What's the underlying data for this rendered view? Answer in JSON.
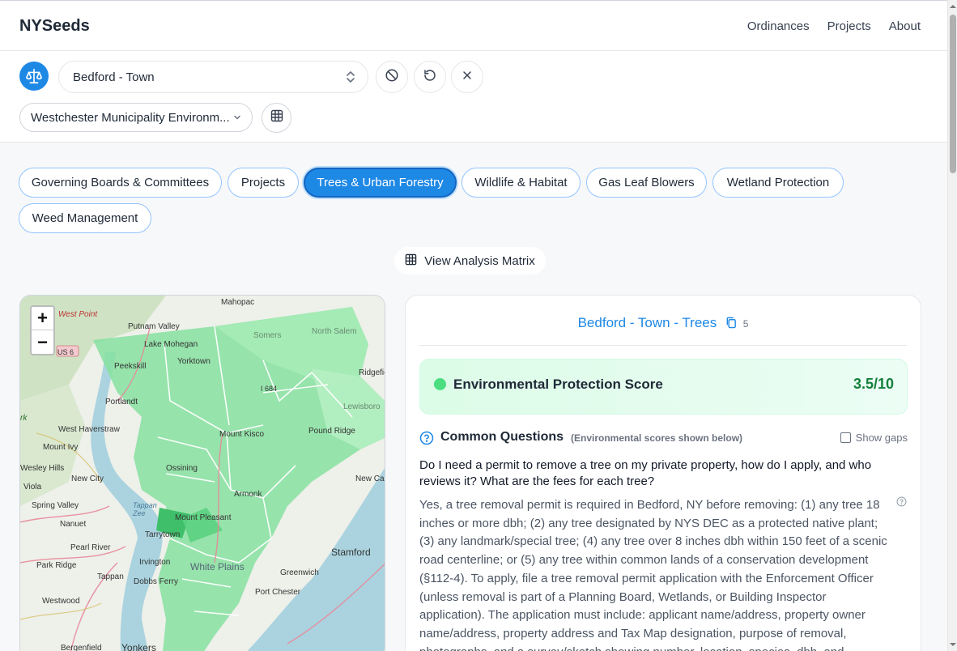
{
  "nav": {
    "brand": "NYSeeds",
    "links": [
      "Ordinances",
      "Projects",
      "About"
    ]
  },
  "controls": {
    "municipality": "Bedford - Town",
    "dataset": "Westchester Municipality Environm..."
  },
  "tabs": [
    "Governing Boards & Committees",
    "Projects",
    "Trees & Urban Forestry",
    "Wildlife & Habitat",
    "Gas Leaf Blowers",
    "Wetland Protection",
    "Weed Management"
  ],
  "active_tab": "Trees & Urban Forestry",
  "matrix_button": "View Analysis Matrix",
  "map": {
    "labels": [
      "West Point",
      "Mahopac",
      "Putnam Valley",
      "Lake Mohegan",
      "Somers",
      "North Salem",
      "US 6",
      "Peekskill",
      "Yorktown",
      "Ridgefield",
      "Portlandt",
      "I 684",
      "Lewisboro",
      "West Haverstraw",
      "Mount Kisco",
      "Pound Ridge",
      "Mount Ivy",
      "Wesley Hills",
      "New City",
      "New Ca",
      "Viola",
      "Ossining",
      "Armonk",
      "Spring Valley",
      "Tappan Zee",
      "Nanuet",
      "Mount Pleasant",
      "Tarrytown",
      "Pearl River",
      "Irvington",
      "Stamford",
      "White Plains",
      "Park Ridge",
      "Tappan",
      "Dobbs Ferry",
      "Greenwich",
      "Port Chester",
      "Westwood",
      "Bergenfield",
      "Yonkers",
      "rk"
    ]
  },
  "panel": {
    "title": "Bedford - Town - Trees",
    "count": "5",
    "score_label": "Environmental Protection Score",
    "score_value": "3.5/10",
    "common_questions_title": "Common Questions",
    "common_questions_subtitle": "(Environmental scores shown below)",
    "show_gaps_label": "Show gaps",
    "question": "Do I need a permit to remove a tree on my private property, how do I apply, and who reviews it? What are the fees for each tree?",
    "answer": "Yes, a tree removal permit is required in Bedford, NY before removing: (1) any tree 18 inches or more dbh; (2) any tree designated by NYS DEC as a protected native plant; (3) any landmark/special tree; (4) any tree over 8 inches dbh within 150 feet of a scenic road centerline; or (5) any tree within common lands of a conservation development (§112-4). To apply, file a tree removal permit application with the Enforcement Officer (unless removal is part of a Planning Board, Wetlands, or Building Inspector application). The application must include: applicant name/address, property owner name/address, property address and Tax Map designation, purpose of removal, photographs, and a survey/sketch showing number, location, species, dbh, and"
  },
  "colors": {
    "accent": "#1e88e5",
    "score_green": "#15803d",
    "map_green": "#86e0a0"
  }
}
